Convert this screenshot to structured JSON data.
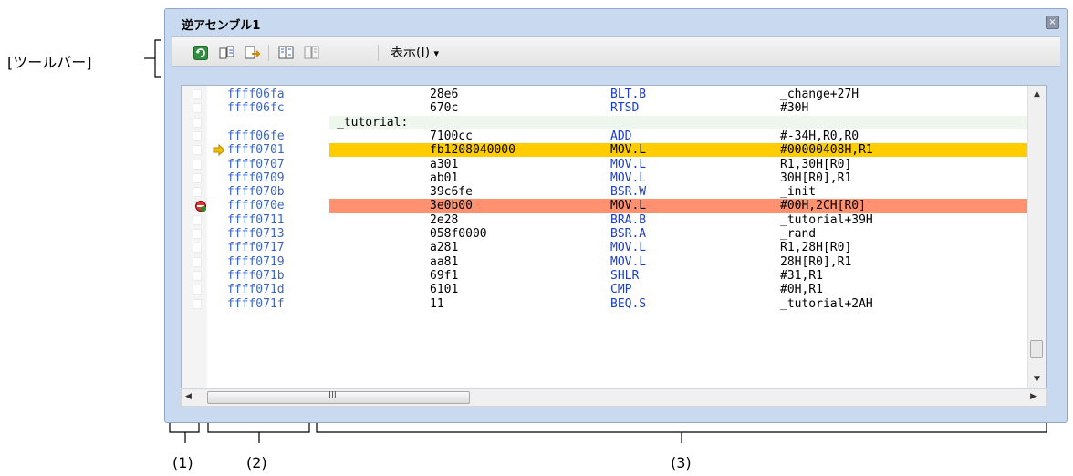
{
  "window": {
    "title": "逆アセンブル1",
    "close_glyph": "×"
  },
  "toolbar": {
    "view_menu_label": "表示(I)",
    "view_menu_arrow": "▾",
    "buttons": [
      "refresh-icon",
      "go-to-symbol-icon",
      "export-icon",
      "mixed-display-icon",
      "disassemble-display-icon"
    ]
  },
  "listing": {
    "rows": [
      {
        "type": "code",
        "address": "ffff06fa",
        "code": "28e6",
        "mnemonic": "BLT.B",
        "operands": "_change+27H"
      },
      {
        "type": "code",
        "address": "ffff06fc",
        "code": "670c",
        "mnemonic": "RTSD",
        "operands": "#30H"
      },
      {
        "type": "label",
        "label": "_tutorial:"
      },
      {
        "type": "code",
        "address": "ffff06fe",
        "code": "7100cc",
        "mnemonic": "ADD",
        "operands": "#-34H,R0,R0"
      },
      {
        "type": "current",
        "address": "ffff0701",
        "code": "fb1208040000",
        "mnemonic": "MOV.L",
        "operands": "#00000408H,R1"
      },
      {
        "type": "code",
        "address": "ffff0707",
        "code": "a301",
        "mnemonic": "MOV.L",
        "operands": "R1,30H[R0]"
      },
      {
        "type": "code",
        "address": "ffff0709",
        "code": "ab01",
        "mnemonic": "MOV.L",
        "operands": "30H[R0],R1"
      },
      {
        "type": "code",
        "address": "ffff070b",
        "code": "39c6fe",
        "mnemonic": "BSR.W",
        "operands": "_init"
      },
      {
        "type": "breakpoint",
        "address": "ffff070e",
        "code": "3e0b00",
        "mnemonic": "MOV.L",
        "operands": "#00H,2CH[R0]"
      },
      {
        "type": "code",
        "address": "ffff0711",
        "code": "2e28",
        "mnemonic": "BRA.B",
        "operands": "_tutorial+39H"
      },
      {
        "type": "code",
        "address": "ffff0713",
        "code": "058f0000",
        "mnemonic": "BSR.A",
        "operands": "_rand"
      },
      {
        "type": "code",
        "address": "ffff0717",
        "code": "a281",
        "mnemonic": "MOV.L",
        "operands": "R1,28H[R0]"
      },
      {
        "type": "code",
        "address": "ffff0719",
        "code": "aa81",
        "mnemonic": "MOV.L",
        "operands": "28H[R0],R1"
      },
      {
        "type": "code",
        "address": "ffff071b",
        "code": "69f1",
        "mnemonic": "SHLR",
        "operands": "#31,R1"
      },
      {
        "type": "code",
        "address": "ffff071d",
        "code": "6101",
        "mnemonic": "CMP",
        "operands": "#0H,R1"
      },
      {
        "type": "code",
        "address": "ffff071f",
        "code": "11",
        "mnemonic": "BEQ.S",
        "operands": "_tutorial+2AH"
      }
    ]
  },
  "scrollbars": {
    "up_glyph": "▲",
    "down_glyph": "▼",
    "left_glyph": "◀",
    "right_glyph": "▶",
    "grip_glyph": "III"
  },
  "annotations": {
    "toolbar_label": "[ツールバー]",
    "area1": "(1)",
    "area2": "(2)",
    "area3": "(3)"
  },
  "colors": {
    "current_line": "#ffcc00",
    "breakpoint_line": "#ff9070",
    "address": "#3a66c8",
    "mnemonic": "#1d3fc4"
  }
}
